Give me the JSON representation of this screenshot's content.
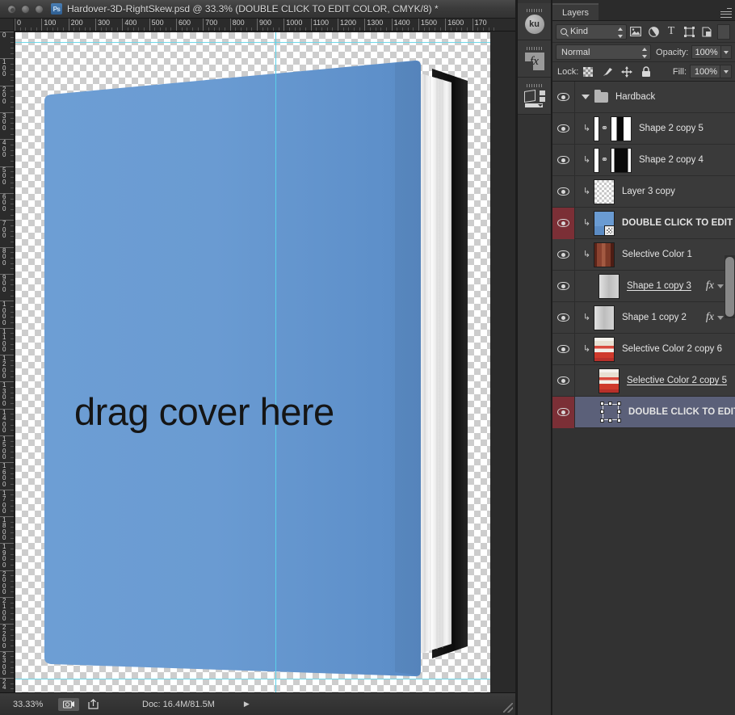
{
  "window": {
    "title": "Hardover-3D-RightSkew.psd @ 33.3% (DOUBLE CLICK TO EDIT COLOR, CMYK/8) *",
    "app_icon": "Ps",
    "traffic_lights": [
      "close-button",
      "minimize-button",
      "zoom-button"
    ]
  },
  "rulers": {
    "horizontal_ticks": [
      "0",
      "100",
      "200",
      "300",
      "400",
      "500",
      "600",
      "700",
      "800",
      "900",
      "1000",
      "1100",
      "1200",
      "1300",
      "1400",
      "1500",
      "1600",
      "170"
    ],
    "vertical_ticks": [
      "0",
      "100",
      "200",
      "300",
      "400",
      "500",
      "600",
      "700",
      "800",
      "900",
      "1000",
      "1100",
      "1200",
      "1300",
      "1400",
      "1500",
      "1600",
      "1700",
      "1800",
      "1900",
      "2000",
      "2100",
      "2200",
      "2300",
      "24"
    ]
  },
  "canvas": {
    "cover_text": "drag cover here",
    "cover_color": "#6a9bd2",
    "guide_color": "#5ad1e8",
    "page_edge_color": "#f2f2f2",
    "spine_dark_color": "#111111"
  },
  "status_bar": {
    "zoom": "33.33%",
    "doc_size": "Doc: 16.4M/81.5M",
    "arrow_glyph": "▶",
    "icons": [
      "camera-icon",
      "share-icon"
    ]
  },
  "mini_dock": {
    "items": [
      {
        "name": "kuler-panel-button",
        "label": "ku"
      },
      {
        "name": "styles-panel-button",
        "label": "fx"
      },
      {
        "name": "adjustments-panel-button",
        "label": ""
      }
    ]
  },
  "layers_panel": {
    "tab_label": "Layers",
    "filter": {
      "kind_label": "Kind",
      "icons": [
        "pixel-filter-icon",
        "adjustment-filter-icon",
        "type-filter-icon",
        "shape-filter-icon",
        "smartobject-filter-icon"
      ]
    },
    "blend_mode": "Normal",
    "opacity_label": "Opacity:",
    "opacity_value": "100%",
    "lock_label": "Lock:",
    "fill_label": "Fill:",
    "fill_value": "100%",
    "lock_icons": [
      "lock-transparency-icon",
      "lock-image-icon",
      "lock-position-icon",
      "lock-all-icon"
    ],
    "layers": [
      {
        "name": "Hardback",
        "type": "group",
        "visible": true,
        "eye_red": false,
        "selected": false,
        "clipped": false,
        "expanded": true,
        "thumb": "none",
        "fx": false,
        "underline": false,
        "caps": false
      },
      {
        "name": "Shape 2 copy 5",
        "type": "shape-mask",
        "visible": true,
        "eye_red": false,
        "selected": false,
        "clipped": true,
        "linked": true,
        "thumb": "halfblack",
        "fx": false,
        "underline": false,
        "caps": false
      },
      {
        "name": "Shape 2 copy 4",
        "type": "shape-mask",
        "visible": true,
        "eye_red": false,
        "selected": false,
        "clipped": true,
        "linked": true,
        "thumb": "black",
        "fx": false,
        "underline": false,
        "caps": false
      },
      {
        "name": "Layer 3 copy",
        "type": "pixel",
        "visible": true,
        "eye_red": false,
        "selected": false,
        "clipped": true,
        "linked": false,
        "thumb": "checker",
        "fx": false,
        "underline": false,
        "caps": false
      },
      {
        "name": "DOUBLE CLICK TO EDIT",
        "type": "smartobject",
        "visible": true,
        "eye_red": true,
        "selected": false,
        "clipped": true,
        "linked": false,
        "thumb": "bluecover",
        "fx": false,
        "underline": false,
        "caps": true
      },
      {
        "name": "Selective Color 1",
        "type": "pixel",
        "visible": true,
        "eye_red": false,
        "selected": false,
        "clipped": true,
        "linked": false,
        "thumb": "brownbook",
        "fx": false,
        "underline": false,
        "caps": false
      },
      {
        "name": "Shape 1 copy 3",
        "type": "shape",
        "visible": true,
        "eye_red": false,
        "selected": false,
        "clipped": false,
        "linked": false,
        "thumb": "graybox",
        "fx": true,
        "underline": true,
        "caps": false
      },
      {
        "name": "Shape 1 copy 2",
        "type": "shape",
        "visible": true,
        "eye_red": false,
        "selected": false,
        "clipped": true,
        "linked": false,
        "thumb": "graybox",
        "fx": true,
        "underline": false,
        "caps": false
      },
      {
        "name": "Selective Color 2 copy 6",
        "type": "pixel",
        "visible": true,
        "eye_red": false,
        "selected": false,
        "clipped": true,
        "linked": false,
        "thumb": "redcover",
        "fx": false,
        "underline": false,
        "caps": false
      },
      {
        "name": "Selective Color 2 copy 5",
        "type": "pixel",
        "visible": true,
        "eye_red": false,
        "selected": false,
        "clipped": false,
        "linked": false,
        "thumb": "redcover",
        "fx": false,
        "underline": true,
        "caps": false
      },
      {
        "name": "DOUBLE CLICK TO EDIT COL...",
        "type": "transform",
        "visible": true,
        "eye_red": true,
        "selected": true,
        "clipped": false,
        "linked": false,
        "thumb": "transform",
        "fx": false,
        "underline": false,
        "caps": true
      }
    ]
  }
}
